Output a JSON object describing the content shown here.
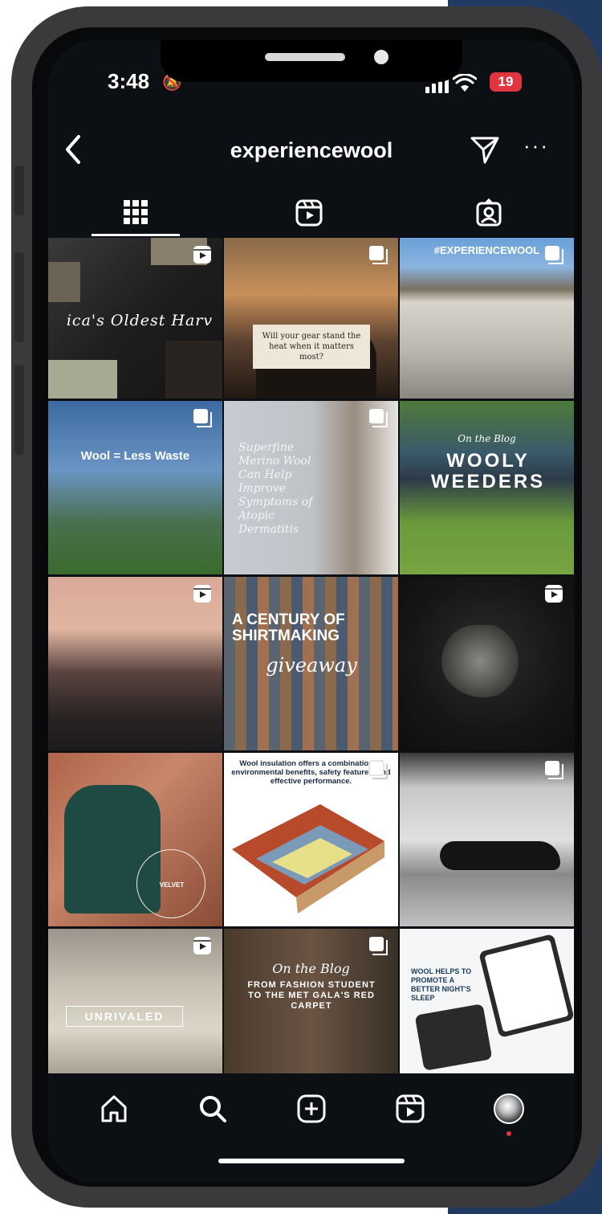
{
  "status": {
    "time": "3:48",
    "battery": "19"
  },
  "header": {
    "username": "experiencewool"
  },
  "posts": [
    {
      "type": "reel",
      "title": "ica's Oldest Harv",
      "caption": ""
    },
    {
      "type": "carousel",
      "title": "",
      "caption": "Will your gear stand the heat when it matters most?"
    },
    {
      "type": "carousel",
      "title": "#EXPERIENCEWOOL",
      "caption": ""
    },
    {
      "type": "carousel",
      "title": "Wool = Less Waste",
      "caption": ""
    },
    {
      "type": "carousel",
      "title": "Superfine Merino Wool Can Help Improve Symptoms of Atopic Dermatitis",
      "caption": ""
    },
    {
      "type": "none",
      "title": "WOOLY WEEDERS",
      "caption": "On the Blog"
    },
    {
      "type": "reel",
      "title": "",
      "caption": ""
    },
    {
      "type": "none",
      "title": "A CENTURY OF SHIRTMAKING",
      "caption": "giveaway"
    },
    {
      "type": "reel",
      "title": "",
      "caption": ""
    },
    {
      "type": "none",
      "title": "VELVET",
      "caption": ""
    },
    {
      "type": "carousel",
      "title": "Wool insulation offers a combination of environmental benefits, safety features, and effective performance.",
      "caption": ""
    },
    {
      "type": "carousel",
      "title": "",
      "caption": ""
    },
    {
      "type": "reel",
      "title": "UNRIVALED",
      "caption": ""
    },
    {
      "type": "carousel",
      "title": "FROM FASHION STUDENT TO THE MET GALA'S RED CARPET",
      "caption": "On the Blog"
    },
    {
      "type": "none",
      "title": "WOOL HELPS TO PROMOTE A BETTER NIGHT'S SLEEP",
      "caption": ""
    }
  ],
  "colors": {
    "accent_blue": "#213a61",
    "battery_red": "#e0353f",
    "notification_dot": "#e0353f"
  },
  "icons": [
    "back-chevron-icon",
    "send-icon",
    "more-icon",
    "grid-icon",
    "reels-icon",
    "tagged-icon",
    "home-icon",
    "search-icon",
    "create-icon",
    "reels-nav-icon",
    "profile-avatar"
  ]
}
